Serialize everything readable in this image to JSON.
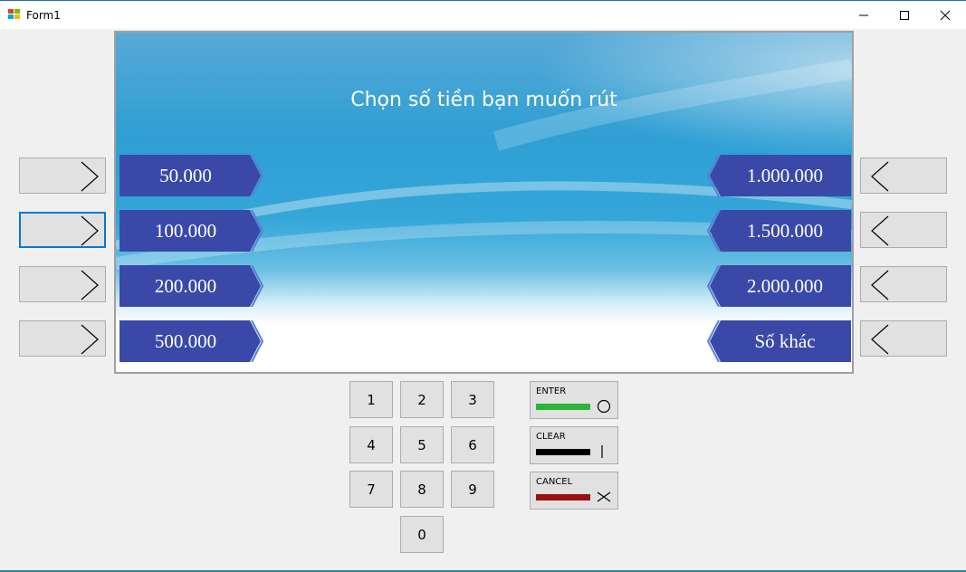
{
  "window": {
    "title": "Form1",
    "minimize_symbol": "–",
    "maximize_symbol": "☐",
    "close_symbol": "✕"
  },
  "screen": {
    "prompt": "Chọn số tiền bạn muốn rút",
    "left_amounts": [
      "50.000",
      "100.000",
      "200.000",
      "500.000"
    ],
    "right_amounts": [
      "1.000.000",
      "1.500.000",
      "2.000.000",
      "Số khác"
    ]
  },
  "keypad": {
    "keys": [
      "1",
      "2",
      "3",
      "4",
      "5",
      "6",
      "7",
      "8",
      "9",
      "0"
    ]
  },
  "function_keys": {
    "enter": {
      "label": "ENTER",
      "color": "#2db53a",
      "icon": "circle-icon"
    },
    "clear": {
      "label": "CLEAR",
      "color": "#000000",
      "icon": "bar-icon"
    },
    "cancel": {
      "label": "CANCEL",
      "color": "#9b1010",
      "icon": "x-icon"
    }
  },
  "colors": {
    "amount_button": "#3a49a8",
    "amount_border": "#5b7fd1",
    "accent_focus": "#0078d7"
  }
}
